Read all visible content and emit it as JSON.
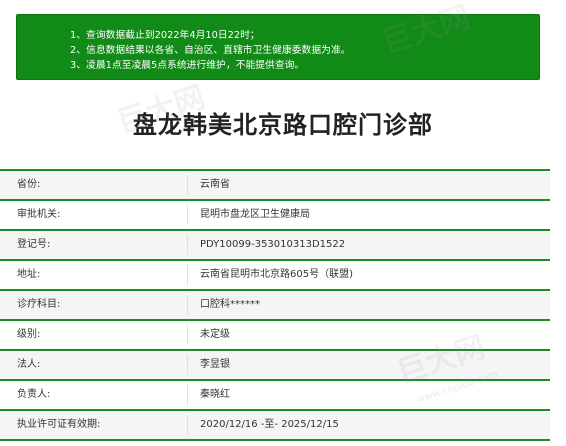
{
  "notice": {
    "lines": [
      "1、查询数据截止到2022年4月10日22时；",
      "2、信息数据结果以各省、自治区、直辖市卫生健康委数据为准。",
      "3、凌晨1点至凌晨5点系统进行维护，不能提供查询。"
    ]
  },
  "title": "盘龙韩美北京路口腔门诊部",
  "rows": [
    {
      "label": "省份:",
      "value": "云南省"
    },
    {
      "label": "审批机关:",
      "value": "昆明市盘龙区卫生健康局"
    },
    {
      "label": "登记号:",
      "value": "PDY10099-353010313D1522"
    },
    {
      "label": "地址:",
      "value": "云南省昆明市北京路605号（联盟)"
    },
    {
      "label": "诊疗科目:",
      "value": "口腔科******"
    },
    {
      "label": "级别:",
      "value": "未定级"
    },
    {
      "label": "法人:",
      "value": "李昱银"
    },
    {
      "label": "负责人:",
      "value": "秦晓红"
    },
    {
      "label": "执业许可证有效期:",
      "value": "2020/12/16 -至- 2025/12/15"
    }
  ],
  "watermark": {
    "text": "巨大网",
    "url": "www.cnjuda.com"
  }
}
